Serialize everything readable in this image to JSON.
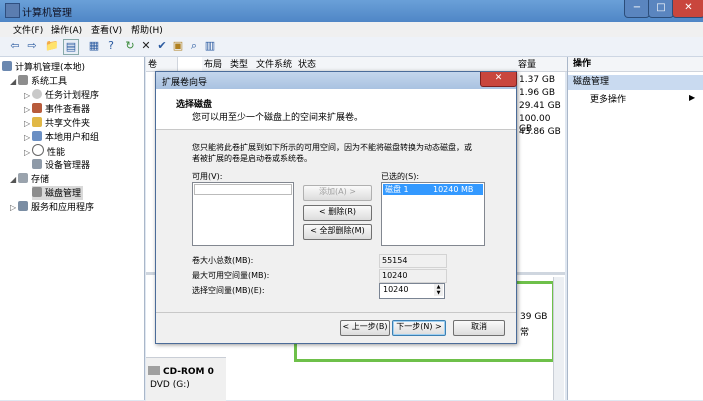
{
  "window": {
    "title": "计算机管理"
  },
  "menu": [
    "文件(F)",
    "操作(A)",
    "查看(V)",
    "帮助(H)"
  ],
  "tree": {
    "root": "计算机管理(本地)",
    "system_tools": "系统工具",
    "task_scheduler": "任务计划程序",
    "event_viewer": "事件查看器",
    "shared_folders": "共享文件夹",
    "local_users": "本地用户和组",
    "performance": "性能",
    "device_manager": "设备管理器",
    "storage": "存储",
    "disk_management": "磁盘管理",
    "services": "服务和应用程序"
  },
  "columns": {
    "vol": "卷",
    "layout": "布局",
    "type": "类型",
    "fs": "文件系统",
    "status": "状态",
    "capacity": "容量"
  },
  "capacities": [
    "1.37 GB",
    "1.96 GB",
    "29.41 GB",
    "100.00 GB",
    "43.86 GB"
  ],
  "lower": {
    "cap1": "39 GB",
    "cap2": "常"
  },
  "cdrom": {
    "name": "CD-ROM 0",
    "drive": "DVD (G:)"
  },
  "actions": {
    "header": "操作",
    "disk_mgmt": "磁盘管理",
    "more": "更多操作"
  },
  "dialog": {
    "title": "扩展卷向导",
    "heading": "选择磁盘",
    "subheading": "您可以用至少一个磁盘上的空间来扩展卷。",
    "note_line1": "您只能将此卷扩展到如下所示的可用空间，因为不能将磁盘转换为动态磁盘，或",
    "note_line2": "者被扩展的卷是启动卷或系统卷。",
    "available_label": "可用(V):",
    "selected_label": "已选的(S):",
    "add_btn": "添加(A) >",
    "remove_btn": "< 删除(R)",
    "remove_all_btn": "< 全部删除(M)",
    "selected_item_disk": "磁盘 1",
    "selected_item_size": "10240 MB",
    "total_label": "卷大小总数(MB):",
    "total_value": "55154",
    "max_label": "最大可用空间量(MB):",
    "max_value": "10240",
    "select_label": "选择空间量(MB)(E):",
    "select_value": "10240",
    "back_btn": "< 上一步(B)",
    "next_btn": "下一步(N) >",
    "cancel_btn": "取消"
  },
  "colors": {
    "selection": "#3399ff",
    "green": "#6ec04a"
  }
}
